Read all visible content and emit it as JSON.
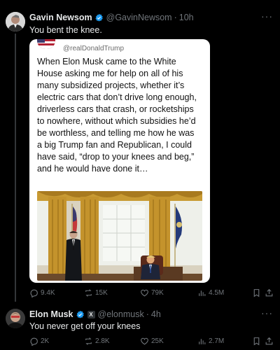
{
  "post": {
    "author_name": "Gavin Newsom",
    "author_handle": "@GavinNewsom",
    "time": "10h",
    "text": "You bent the knee.",
    "more": "···",
    "quoted_card": {
      "handle": "@realDonaldTrump",
      "lines": [
        "When Elon Musk came to the White",
        "House asking me for help on all of his",
        "many subsidized projects, whether it’s",
        "electric cars that don’t drive long enough,",
        "driverless cars that crash, or rocketships",
        "to nowhere, without which subsidies he’d",
        "be worthless, and telling me how he was",
        "a big Trump fan and Republican, I could",
        "have said, “drop to your knees and beg,”",
        "and he would have done it…"
      ]
    },
    "stats": {
      "replies": "9.4K",
      "reposts": "15K",
      "likes": "79K",
      "views": "4.5M"
    }
  },
  "reply": {
    "author_name": "Elon Musk",
    "badge_x": "X",
    "author_handle": "@elonmusk",
    "time": "4h",
    "text": "You never get off your knees",
    "more": "···",
    "stats": {
      "replies": "2K",
      "reposts": "2.8K",
      "likes": "25K",
      "views": "2.7M"
    }
  },
  "colors": {
    "background": "#000000",
    "text": "#e7e9ea",
    "muted": "#71767b",
    "verified": "#1d9bf0",
    "card": "#ffffff"
  },
  "icons": [
    "verified-badge-icon",
    "reply-icon",
    "repost-icon",
    "like-icon",
    "views-icon",
    "bookmark-icon",
    "share-icon",
    "more-icon"
  ]
}
